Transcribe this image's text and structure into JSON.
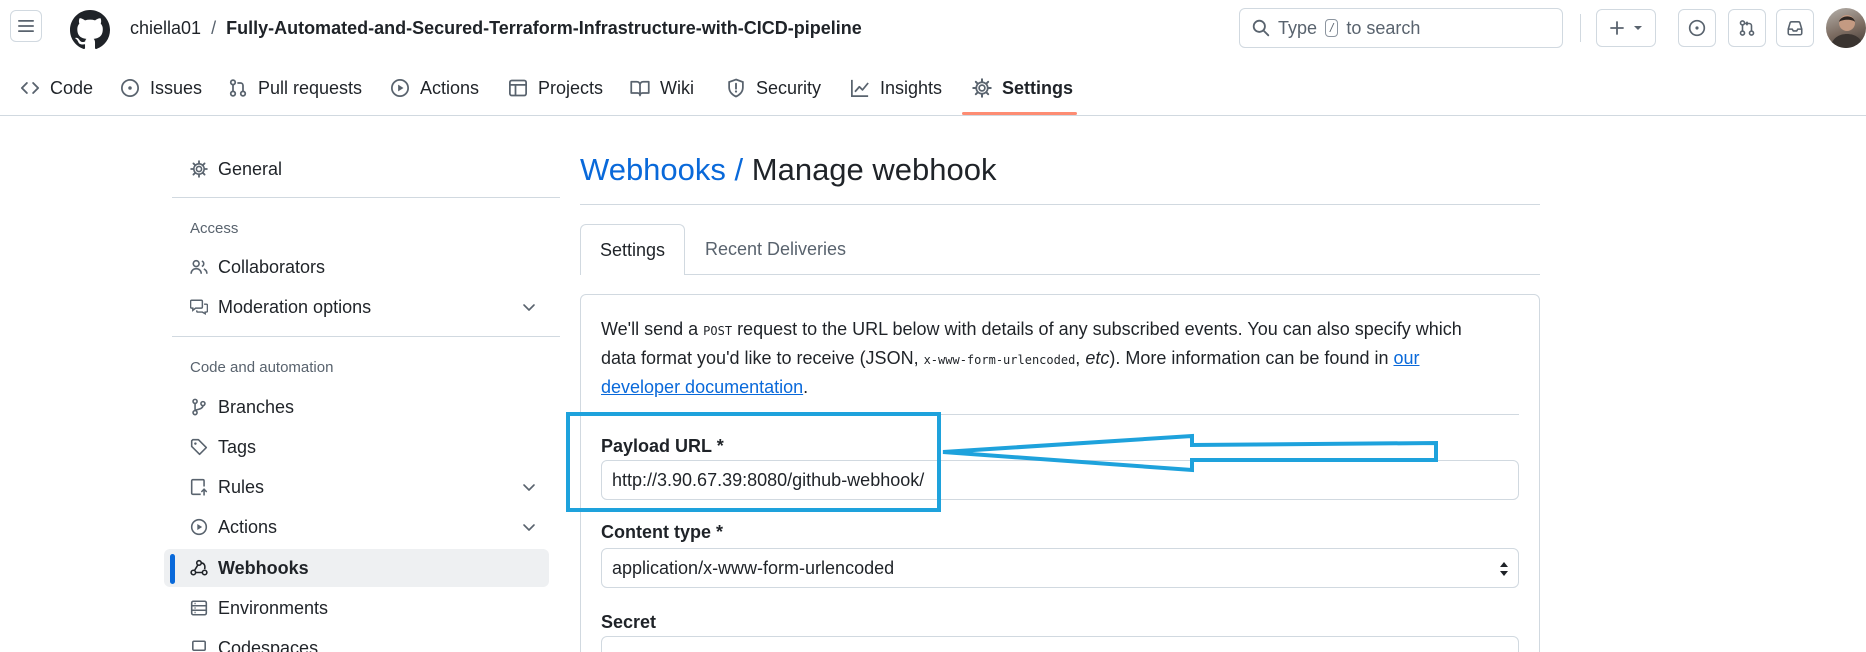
{
  "header": {
    "owner": "chiella01",
    "separator": "/",
    "repo": "Fully-Automated-and-Secured-Terraform-Infrastructure-with-CICD-pipeline",
    "search_prefix": "Type",
    "search_key": "/",
    "search_suffix": "to search",
    "icons": [
      "hamburger-icon",
      "github-logo",
      "search-icon",
      "plus-icon",
      "chevron-down-icon",
      "issue-icon",
      "pull-request-icon",
      "inbox-icon"
    ]
  },
  "repo_nav": {
    "tabs": [
      {
        "label": "Code",
        "icon": "code-icon"
      },
      {
        "label": "Issues",
        "icon": "issue-icon"
      },
      {
        "label": "Pull requests",
        "icon": "pull-request-icon"
      },
      {
        "label": "Actions",
        "icon": "play-icon"
      },
      {
        "label": "Projects",
        "icon": "table-icon"
      },
      {
        "label": "Wiki",
        "icon": "book-icon"
      },
      {
        "label": "Security",
        "icon": "shield-icon"
      },
      {
        "label": "Insights",
        "icon": "graph-icon"
      },
      {
        "label": "Settings",
        "icon": "gear-icon",
        "active": true
      }
    ]
  },
  "sidebar": {
    "general": "General",
    "access_heading": "Access",
    "collaborators": "Collaborators",
    "moderation": "Moderation options",
    "code_heading": "Code and automation",
    "branches": "Branches",
    "tags": "Tags",
    "rules": "Rules",
    "actions": "Actions",
    "webhooks": "Webhooks",
    "environments": "Environments",
    "codespaces": "Codespaces",
    "selected": "Webhooks"
  },
  "main": {
    "title_link": "Webhooks /",
    "title": "Manage webhook",
    "tabs": {
      "settings": "Settings",
      "recent": "Recent Deliveries"
    },
    "intro": {
      "t1": "We'll send a ",
      "code1": "POST",
      "t2": " request to the URL below with details of any subscribed events. You can also specify which data format you'd like to receive (JSON, ",
      "code2": "x-www-form-urlencoded",
      "t3": ", ",
      "etc": "etc",
      "t4": "). More information can be found in ",
      "link": "our developer documentation",
      "t5": "."
    },
    "payload_label": "Payload URL *",
    "payload_value": "http://3.90.67.39:8080/github-webhook/",
    "content_type_label": "Content type *",
    "content_type_value": "application/x-www-form-urlencoded",
    "secret_label": "Secret"
  },
  "colors": {
    "accent": "#0969da",
    "active_tab_underline": "#fd8c73",
    "annotation": "#1ea2dc"
  }
}
